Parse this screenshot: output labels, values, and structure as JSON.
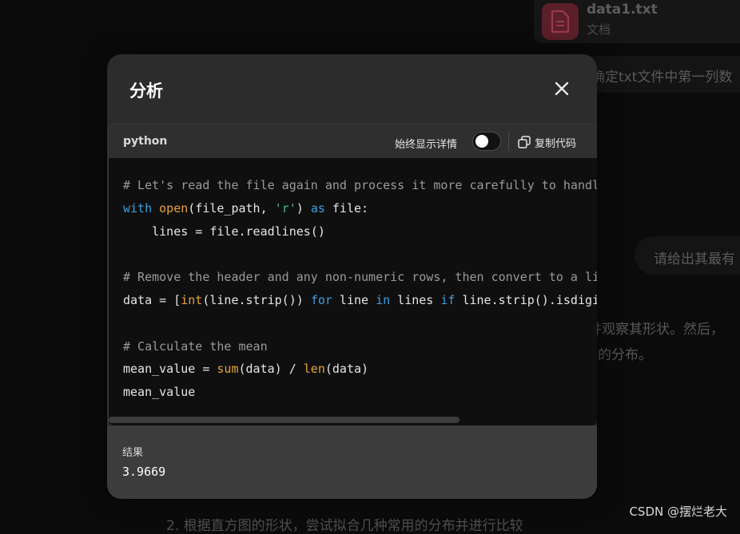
{
  "background": {
    "file_card": {
      "name": "data1.txt",
      "type": "文档"
    },
    "message_1": "确定txt文件中第一列数",
    "message_2": "请给出其最有",
    "text_a": "并观察其形状。然后，",
    "text_b": "的分布。",
    "text_c": "2. 根据直方图的形状，尝试拟合几种常用的分布并进行比较",
    "watermark": "CSDN @摆烂老大"
  },
  "modal": {
    "title": "分析",
    "close_icon": "close-icon",
    "code": {
      "language": "python",
      "toggle_label": "始终显示详情",
      "toggle_on": false,
      "copy_label": "复制代码",
      "lines": [
        [
          {
            "t": "# Let's read the file again and process it more carefully to handle",
            "c": "cm"
          }
        ],
        [
          {
            "t": "with",
            "c": "kw"
          },
          {
            "t": " "
          },
          {
            "t": "open",
            "c": "fn"
          },
          {
            "t": "(file_path, "
          },
          {
            "t": "'r'",
            "c": "str"
          },
          {
            "t": ") "
          },
          {
            "t": "as",
            "c": "kw"
          },
          {
            "t": " file:"
          }
        ],
        [
          {
            "t": "    lines = file.readlines()"
          }
        ],
        [
          {
            "t": ""
          }
        ],
        [
          {
            "t": "# Remove the header and any non-numeric rows, then convert to a list",
            "c": "cm"
          }
        ],
        [
          {
            "t": "data = ["
          },
          {
            "t": "int",
            "c": "fn"
          },
          {
            "t": "(line.strip()) "
          },
          {
            "t": "for",
            "c": "kw"
          },
          {
            "t": " line "
          },
          {
            "t": "in",
            "c": "kw"
          },
          {
            "t": " lines "
          },
          {
            "t": "if",
            "c": "kw"
          },
          {
            "t": " line.strip().isdigit()]"
          }
        ],
        [
          {
            "t": ""
          }
        ],
        [
          {
            "t": "# Calculate the mean",
            "c": "cm"
          }
        ],
        [
          {
            "t": "mean_value = "
          },
          {
            "t": "sum",
            "c": "fn"
          },
          {
            "t": "(data) / "
          },
          {
            "t": "len",
            "c": "fn"
          },
          {
            "t": "(data)"
          }
        ],
        [
          {
            "t": "mean_value"
          }
        ]
      ]
    },
    "result": {
      "label": "结果",
      "value": "3.9669"
    }
  },
  "colors": {
    "comment": "#9a9a9a",
    "keyword": "#3f9ddd",
    "builtin": "#e8a33d",
    "string": "#3fbf8f",
    "modal_bg": "#2c2c2c",
    "code_bg": "#0f0f0f"
  }
}
